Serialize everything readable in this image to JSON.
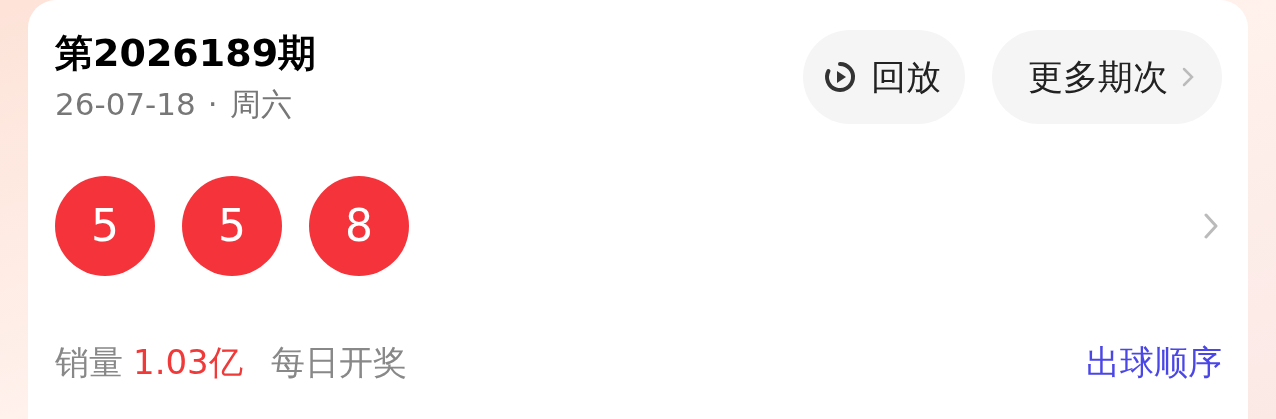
{
  "draw": {
    "title": "第2026189期",
    "date": "26-07-18",
    "separator": "·",
    "weekday": "周六"
  },
  "buttons": [
    {
      "kind": "replay",
      "label": "回放"
    },
    {
      "kind": "more",
      "label": "更多期次"
    }
  ],
  "balls": [
    "5",
    "5",
    "8"
  ],
  "footer": {
    "sales_label": "销量",
    "sales_value": "1.03亿",
    "frequency": "每日开奖",
    "link": "出球顺序"
  }
}
